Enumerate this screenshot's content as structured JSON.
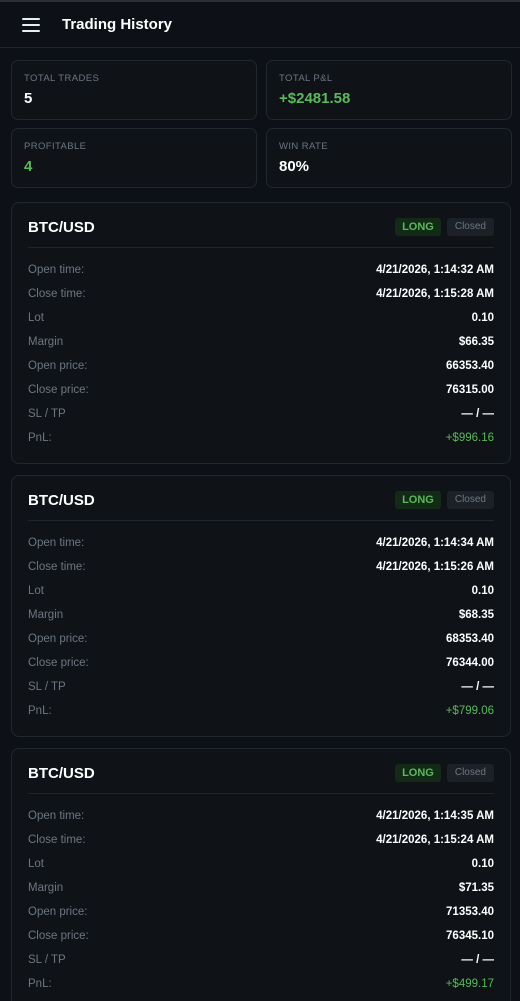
{
  "header": {
    "title": "Trading History"
  },
  "stats": [
    {
      "label": "TOTAL TRADES",
      "value": "5",
      "positive": false
    },
    {
      "label": "TOTAL P&L",
      "value": "+$2481.58",
      "positive": true
    },
    {
      "label": "PROFITABLE",
      "value": "4",
      "positive": true
    },
    {
      "label": "WIN RATE",
      "value": "80%",
      "positive": false
    }
  ],
  "labels": {
    "open_time": "Open time:",
    "close_time": "Close time:",
    "lot": "Lot",
    "margin": "Margin",
    "open_price": "Open price:",
    "close_price": "Close price:",
    "sl_tp": "SL / TP",
    "pnl": "PnL:"
  },
  "trades": [
    {
      "pair": "BTC/USD",
      "side": "LONG",
      "status": "Closed",
      "open_time": "4/21/2026, 1:14:32 AM",
      "close_time": "4/21/2026, 1:15:28 AM",
      "lot": "0.10",
      "margin": "$66.35",
      "open_price": "66353.40",
      "close_price": "76315.00",
      "sl_tp": "— / —",
      "pnl": "+$996.16"
    },
    {
      "pair": "BTC/USD",
      "side": "LONG",
      "status": "Closed",
      "open_time": "4/21/2026, 1:14:34 AM",
      "close_time": "4/21/2026, 1:15:26 AM",
      "lot": "0.10",
      "margin": "$68.35",
      "open_price": "68353.40",
      "close_price": "76344.00",
      "sl_tp": "— / —",
      "pnl": "+$799.06"
    },
    {
      "pair": "BTC/USD",
      "side": "LONG",
      "status": "Closed",
      "open_time": "4/21/2026, 1:14:35 AM",
      "close_time": "4/21/2026, 1:15:24 AM",
      "lot": "0.10",
      "margin": "$71.35",
      "open_price": "71353.40",
      "close_price": "76345.10",
      "sl_tp": "— / —",
      "pnl": "+$499.17"
    }
  ]
}
